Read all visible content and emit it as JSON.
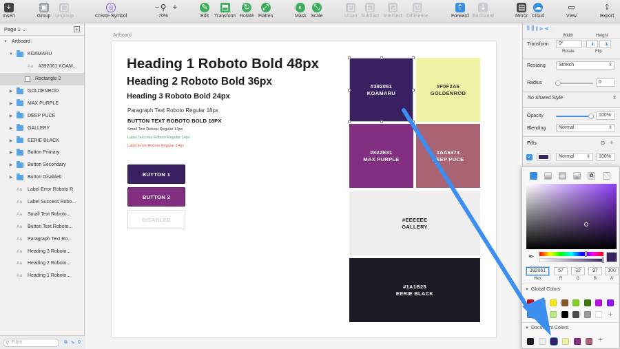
{
  "toolbar": {
    "insert": "Insert",
    "group": "Group",
    "ungroup": "Ungroup",
    "create_symbol": "Create Symbol",
    "zoom_minus": "−",
    "zoom_plus": "+",
    "zoom": "70%",
    "edit": "Edit",
    "transform": "Transform",
    "rotate": "Rotate",
    "flatten": "Flatten",
    "mask": "Mask",
    "scale": "Scale",
    "union": "Union",
    "subtract": "Subtract",
    "intersect": "Intersect",
    "difference": "Difference",
    "forward": "Forward",
    "backward": "Backward",
    "mirror": "Mirror",
    "cloud": "Cloud",
    "view": "View",
    "export": "Export"
  },
  "sidebar": {
    "page": "Page 1 ⌄",
    "artboard": "Artboard",
    "layers": [
      {
        "name": "KOAMARU",
        "kind": "folder",
        "indent": 1,
        "open": true
      },
      {
        "name": "#392061 KOAM...",
        "kind": "text",
        "indent": 2
      },
      {
        "name": "Rectangle 2",
        "kind": "rect",
        "indent": 2,
        "selected": true
      },
      {
        "name": "GOLDENROD",
        "kind": "folder",
        "indent": 1
      },
      {
        "name": "MAX PURPLE",
        "kind": "folder",
        "indent": 1
      },
      {
        "name": "DEEP PUCE",
        "kind": "folder",
        "indent": 1
      },
      {
        "name": "GALLERY",
        "kind": "folder",
        "indent": 1
      },
      {
        "name": "EERIE BLACK",
        "kind": "folder",
        "indent": 1
      },
      {
        "name": "Button Primary",
        "kind": "folder",
        "indent": 1
      },
      {
        "name": "Button Secondary",
        "kind": "folder",
        "indent": 1
      },
      {
        "name": "Button Disabled",
        "kind": "folder",
        "indent": 1
      },
      {
        "name": "Label Error Roboto R",
        "kind": "text",
        "indent": 1
      },
      {
        "name": "Label Success Robo...",
        "kind": "text",
        "indent": 1
      },
      {
        "name": "Small Text Roboto...",
        "kind": "text",
        "indent": 1
      },
      {
        "name": "Button Text Roboto...",
        "kind": "text",
        "indent": 1
      },
      {
        "name": "Paragraph Text Ro...",
        "kind": "text",
        "indent": 1
      },
      {
        "name": "Heading 3 Roboto...",
        "kind": "text",
        "indent": 1
      },
      {
        "name": "Heading 2 Roboto...",
        "kind": "text",
        "indent": 1
      },
      {
        "name": "Heading 1 Roboto...",
        "kind": "text",
        "indent": 1
      }
    ],
    "filter_placeholder": "Filter",
    "badge_count": "0"
  },
  "canvas": {
    "artboard_label": "Artboard",
    "h1": "Heading 1 Roboto Bold 48px",
    "h2": "Heading 2 Roboto Bold 36px",
    "h3": "Heading 3 Roboto Bold 24px",
    "paragraph": "Paragraph Text Roboto Regular 18px",
    "button_text": "BUTTON TEXT ROBOTO BOLD 18PX",
    "small_text": "Small Text Roboto Regular 14px",
    "label_success": "Label Success Roboto Regular 14px",
    "label_error": "Label Error Roboto Regular 14px",
    "button1": "BUTTON 1",
    "button2": "BUTTON 2",
    "disabled": "DISABLED",
    "swatches": [
      {
        "hex": "#392061",
        "name": "KOAMARU",
        "color": "#392061",
        "text": "#ffffff"
      },
      {
        "hex": "#F0F2A6",
        "name": "GOLDENROD",
        "color": "#f0f2a6",
        "text": "#333333"
      },
      {
        "hex": "#822E81",
        "name": "MAX PURPLE",
        "color": "#822e81",
        "text": "#ffffff"
      },
      {
        "hex": "#AA6373",
        "name": "DEEP PUCE",
        "color": "#aa6373",
        "text": "#ffffff"
      },
      {
        "hex": "#EEEEEE",
        "name": "GALLERY",
        "color": "#eeeeee",
        "text": "#222222"
      },
      {
        "hex": "#1A1B25",
        "name": "EERIE BLACK",
        "color": "#1a1b25",
        "text": "#ffffff"
      }
    ]
  },
  "inspector": {
    "width": "Width",
    "height": "Height",
    "transform": "Transform",
    "rotate_value": "0º",
    "rotate": "Rotate",
    "flip": "Flip",
    "resizing": "Resizing",
    "resizing_value": "Stretch",
    "radius": "Radius",
    "radius_value": "0",
    "shared_style": "No Shared Style",
    "opacity": "Opacity",
    "opacity_value": "100%",
    "blending": "Blending",
    "blending_value": "Normal",
    "fills": "Fills",
    "fill_mode": "Normal",
    "fill_opacity": "100%",
    "fill_color": "#392061"
  },
  "picker": {
    "hex": "392061",
    "r": "57",
    "g": "32",
    "b": "97",
    "a": "100",
    "hex_label": "Hex",
    "r_label": "R",
    "g_label": "G",
    "b_label": "B",
    "a_label": "A",
    "global_colors": "Global Colors",
    "document_colors": "Document Colors",
    "global_swatches": [
      "#d0021b",
      "#f5a623",
      "#f8e71c",
      "#8b572a",
      "#7ed321",
      "#417505",
      "#bd10e0",
      "#9013fe",
      "#4a90e2",
      "#50e3c2",
      "#b8e986",
      "#000000",
      "#4a4a4a",
      "#9b9b9b",
      "#ffffff"
    ],
    "document_swatches": [
      "#1a1b25",
      "#eeeeee",
      "#392061",
      "#f0f2a6",
      "#822e81",
      "#aa6373"
    ]
  },
  "accent": "#3b8fe0"
}
